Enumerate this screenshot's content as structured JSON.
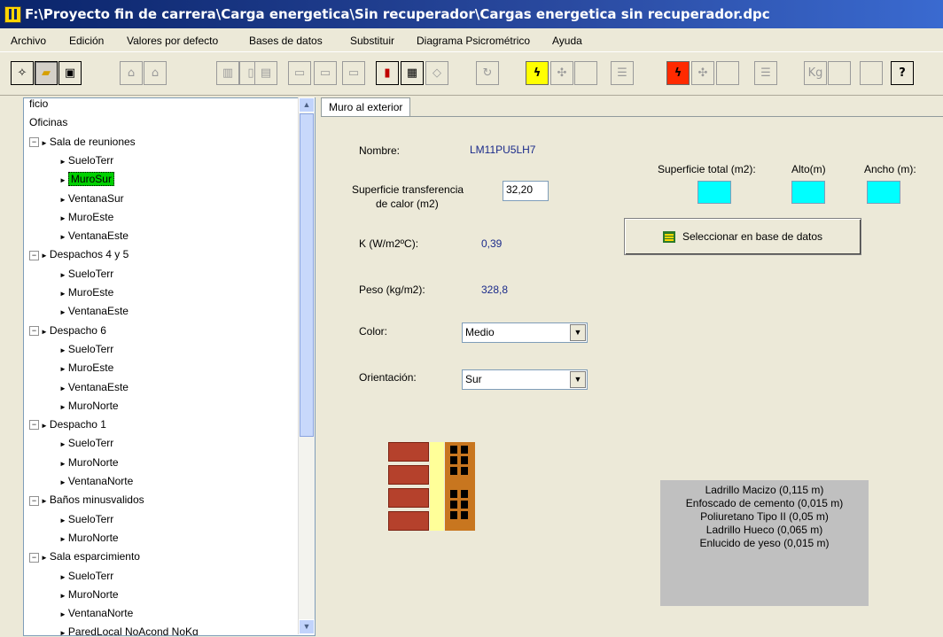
{
  "window": {
    "title": "F:\\Proyecto fin de carrera\\Carga energetica\\Sin recuperador\\Cargas energetica sin recuperador.dpc"
  },
  "menu": [
    "Archivo",
    "Edición",
    "Valores por defecto",
    "Bases de datos",
    "Substituir",
    "Diagrama Psicrométrico",
    "Ayuda"
  ],
  "toolbar": {
    "icons": [
      "new-icon",
      "open-folder-icon",
      "save-icon",
      "building-icon",
      "house-icon",
      "wall-icon",
      "column-icon",
      "door-icon",
      "window-icon",
      "floor-icon",
      "roof-icon",
      "red-device-icon",
      "chip-icon",
      "diamond-icon",
      "refresh-icon",
      "bolt-yellow-icon",
      "fan-icon",
      "blank-icon",
      "report-icon",
      "bolt-red-icon",
      "fan-icon-2",
      "blank-icon-2",
      "report-icon-2",
      "kg-icon",
      "blank-icon-3",
      "blank-icon-4",
      "help-icon"
    ],
    "kg_label": "Kg",
    "help_label": "?"
  },
  "tree": {
    "items": [
      {
        "label": "ficio",
        "level": 0
      },
      {
        "label": "Oficinas",
        "level": 0
      },
      {
        "label": "Sala de reuniones",
        "level": 1,
        "expand": true
      },
      {
        "label": "SueloTerr",
        "level": 2
      },
      {
        "label": "MuroSur",
        "level": 2,
        "selected": true
      },
      {
        "label": "VentanaSur",
        "level": 2
      },
      {
        "label": "MuroEste",
        "level": 2
      },
      {
        "label": "VentanaEste",
        "level": 2
      },
      {
        "label": "Despachos 4 y 5",
        "level": 1,
        "expand": true
      },
      {
        "label": "SueloTerr",
        "level": 2
      },
      {
        "label": "MuroEste",
        "level": 2
      },
      {
        "label": "VentanaEste",
        "level": 2
      },
      {
        "label": "Despacho 6",
        "level": 1,
        "expand": true
      },
      {
        "label": "SueloTerr",
        "level": 2
      },
      {
        "label": "MuroEste",
        "level": 2
      },
      {
        "label": "VentanaEste",
        "level": 2
      },
      {
        "label": "MuroNorte",
        "level": 2
      },
      {
        "label": "Despacho 1",
        "level": 1,
        "expand": true
      },
      {
        "label": "SueloTerr",
        "level": 2
      },
      {
        "label": "MuroNorte",
        "level": 2
      },
      {
        "label": "VentanaNorte",
        "level": 2
      },
      {
        "label": "Baños minusvalidos",
        "level": 1,
        "expand": true
      },
      {
        "label": "SueloTerr",
        "level": 2
      },
      {
        "label": "MuroNorte",
        "level": 2
      },
      {
        "label": "Sala esparcimiento",
        "level": 1,
        "expand": true
      },
      {
        "label": "SueloTerr",
        "level": 2
      },
      {
        "label": "MuroNorte",
        "level": 2
      },
      {
        "label": "VentanaNorte",
        "level": 2
      },
      {
        "label": "ParedLocal NoAcond NoKg",
        "level": 2
      }
    ]
  },
  "tab": {
    "label": "Muro al exterior"
  },
  "form": {
    "nombre_label": "Nombre:",
    "nombre_value": "LM11PU5LH7",
    "superficie_label_1": "Superficie transferencia",
    "superficie_label_2": "de calor  (m2)",
    "superficie_value": "32,20",
    "k_label": "K (W/m2ºC):",
    "k_value": "0,39",
    "peso_label": "Peso (kg/m2):",
    "peso_value": "328,8",
    "color_label": "Color:",
    "color_value": "Medio",
    "orientacion_label": "Orientación:",
    "orientacion_value": "Sur",
    "sup_total_label": "Superficie total (m2):",
    "alto_label": "Alto(m)",
    "ancho_label": "Ancho (m):",
    "db_button": "Seleccionar en base de datos"
  },
  "layers": [
    "Ladrillo Macizo (0,115 m)",
    "Enfoscado de cemento (0,015 m)",
    "Poliuretano Tipo II (0,05 m)",
    "Ladrillo Hueco (0,065 m)",
    "Enlucido de yeso (0,015 m)"
  ],
  "colors": {
    "title_bar": "#0a246a",
    "selected_item": "#00d000",
    "cyan_fields": "#00ffff",
    "value_text": "#1a2a8a"
  }
}
